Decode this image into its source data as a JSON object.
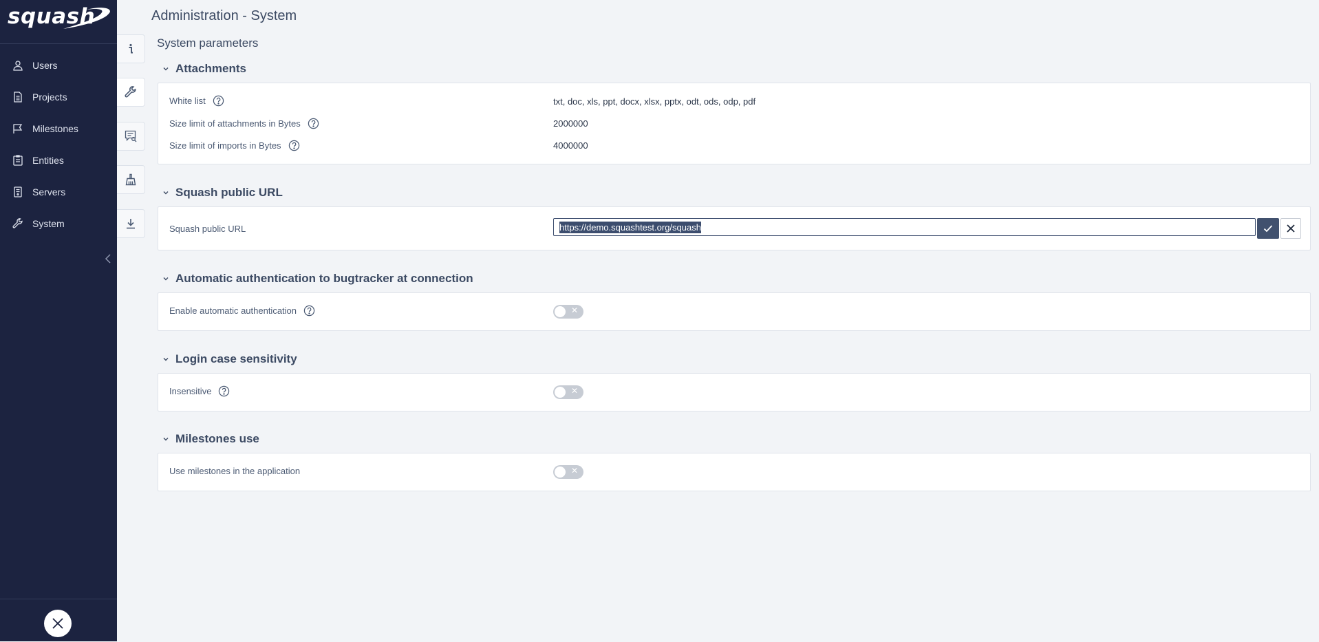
{
  "app": {
    "logo_text": "squash"
  },
  "sidebar": {
    "items": [
      {
        "label": "Users",
        "icon": "user-icon"
      },
      {
        "label": "Projects",
        "icon": "document-icon"
      },
      {
        "label": "Milestones",
        "icon": "flag-icon"
      },
      {
        "label": "Entities",
        "icon": "clipboard-icon"
      },
      {
        "label": "Servers",
        "icon": "server-icon"
      },
      {
        "label": "System",
        "icon": "wrench-icon"
      }
    ]
  },
  "icon_tabs": [
    "info-icon",
    "wrench-icon",
    "message-search-icon",
    "broom-icon",
    "download-icon"
  ],
  "page": {
    "title": "Administration - System",
    "subtitle": "System parameters"
  },
  "attachments": {
    "header": "Attachments",
    "white_list_label": "White list",
    "white_list_value": "txt, doc, xls, ppt, docx, xlsx, pptx, odt, ods, odp, pdf",
    "size_attach_label": "Size limit of attachments in Bytes",
    "size_attach_value": "2000000",
    "size_import_label": "Size limit of imports in Bytes",
    "size_import_value": "4000000"
  },
  "public_url": {
    "header": "Squash public URL",
    "label": "Squash public URL",
    "value": "https://demo.squashtest.org/squash"
  },
  "bugtracker": {
    "header": "Automatic authentication to bugtracker at connection",
    "label": "Enable automatic authentication",
    "enabled": false
  },
  "login_case": {
    "header": "Login case sensitivity",
    "label": "Insensitive",
    "enabled": false
  },
  "milestones_use": {
    "header": "Milestones use",
    "label": "Use milestones in the application",
    "enabled": false
  },
  "colors": {
    "sidebar_bg": "#1c2340",
    "accent": "#41516e",
    "toggle_off": "#c7ccd4"
  }
}
